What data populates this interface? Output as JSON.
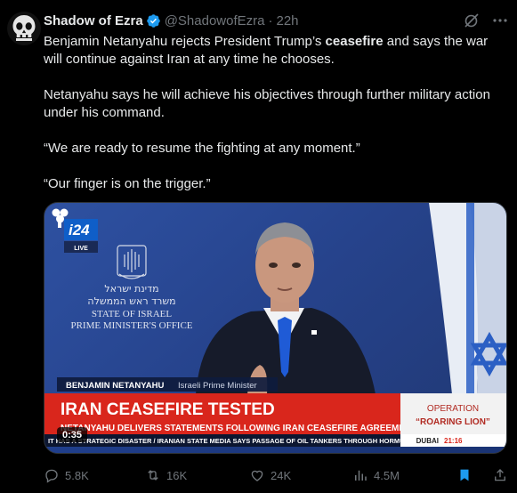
{
  "tweet": {
    "author_name": "Shadow of Ezra",
    "handle": "@ShadowofEzra",
    "separator": "·",
    "time": "22h",
    "paragraphs": [
      {
        "before": "Benjamin Netanyahu rejects President Trump’s ",
        "bold": "ceasefire",
        "after": " and says the war will continue against Iran at any time he chooses."
      },
      {
        "before": "Netanyahu says he will achieve his objectives through further military action under his command.",
        "bold": "",
        "after": ""
      },
      {
        "before": "“We are ready to resume the fighting at any moment.”",
        "bold": "",
        "after": ""
      },
      {
        "before": "“Our finger is on the trigger.”",
        "bold": "",
        "after": ""
      }
    ]
  },
  "video": {
    "channel_logo": "i24",
    "live_label": "LIVE",
    "podium_hebrew_1": "מדינת ישראל",
    "podium_hebrew_2": "משרד ראש הממשלה",
    "podium_line_1": "STATE OF ISRAEL",
    "podium_line_2": "PRIME MINISTER'S OFFICE",
    "lower_third_name": "BENJAMIN NETANYAHU",
    "lower_third_title": "Israeli Prime Minister",
    "headline": "IRAN CEASEFIRE TESTED",
    "subheadline": "NETANYAHU DELIVERS STATEMENTS FOLLOWING IRAN CEASEFIRE AGREEMENT",
    "ticker": "IT HAS A STRATEGIC DISASTER  /  IRANIAN STATE MEDIA SAYS PASSAGE OF OIL TANKERS THROUGH HORMUZ",
    "operation_label": "OPERATION",
    "operation_name": "“ROARING LION”",
    "city": "DUBAI",
    "clock": "21:16",
    "duration": "0:35"
  },
  "actions": {
    "replies": "5.8K",
    "reposts": "16K",
    "likes": "24K",
    "views": "4.5M"
  },
  "colors": {
    "accent_blue": "#1d9bf0",
    "muted_text": "#71767b",
    "news_red": "#d9261c"
  }
}
